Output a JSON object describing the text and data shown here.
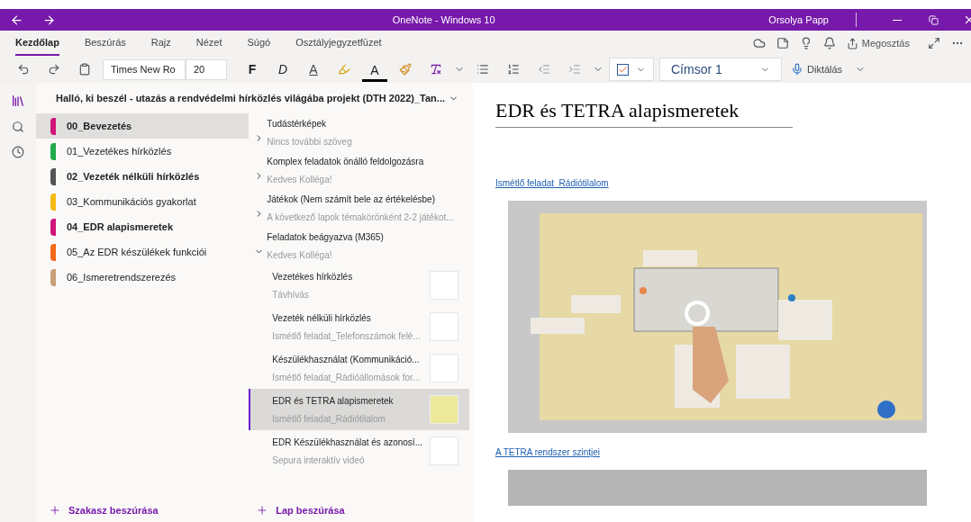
{
  "window": {
    "title": "OneNote - Windows 10",
    "user": "Orsolya Papp"
  },
  "ribbon_tabs": [
    {
      "label": "Kezdőlap",
      "selected": true
    },
    {
      "label": "Beszúrás",
      "selected": false
    },
    {
      "label": "Rajz",
      "selected": false
    },
    {
      "label": "Nézet",
      "selected": false
    },
    {
      "label": "Súgó",
      "selected": false
    },
    {
      "label": "Osztályjegyzetfüzet",
      "selected": false
    }
  ],
  "share": "Megosztás",
  "toolbar": {
    "font": "Times New Ro",
    "size": "20",
    "bold": "F",
    "italic": "D",
    "underline": "A",
    "font_color": "A",
    "tag_checked": true,
    "style": "Címsor 1",
    "dictate": "Diktálás"
  },
  "notebook": {
    "title": "Halló, ki beszél - utazás a rendvédelmi hírközlés világába projekt (DTH 2022)_Tan..."
  },
  "sections": [
    {
      "name": "00_Bevezetés",
      "color": "#d0157a",
      "selected": true,
      "unread": true
    },
    {
      "name": "01_Vezetékes hírközlés",
      "color": "#21a94e",
      "selected": false,
      "unread": false
    },
    {
      "name": "02_Vezeték nélküli hírközlés",
      "color": "#545454",
      "selected": false,
      "unread": true
    },
    {
      "name": "03_Kommunikációs gyakorlat",
      "color": "#f5b915",
      "selected": false,
      "unread": false
    },
    {
      "name": "04_EDR alapismeretek",
      "color": "#d0157a",
      "selected": false,
      "unread": true
    },
    {
      "name": "05_Az EDR készülékek funkciói",
      "color": "#f26a1b",
      "selected": false,
      "unread": false
    },
    {
      "name": "06_Ismeretrendszerezés",
      "color": "#c9a07a",
      "selected": false,
      "unread": false
    }
  ],
  "add_section": "Szakasz beszúrása",
  "pages": [
    {
      "title": "Tudástérképek",
      "preview": "Nincs további szöveg",
      "expanded": false
    },
    {
      "title": "Komplex feladatok önálló feldolgozásra",
      "preview": "Kedves Kolléga!",
      "expanded": false
    },
    {
      "title": "Játékok (Nem számít bele az értékelésbe)",
      "preview": "A következő lapok témakörönként 2-2 játékot...",
      "expanded": false
    },
    {
      "title": "Feladatok beágyazva (M365)",
      "preview": "Kedves Kolléga!",
      "expanded": true,
      "children": [
        {
          "title": "Vezetékes hírközlés",
          "preview": "Távhívás",
          "selected": false
        },
        {
          "title": "Vezeték nélküli hírközlés",
          "preview": "Ismétlő feladat_Telefonszámok felé...",
          "selected": false
        },
        {
          "title": "Készülékhasználat (Kommunikáció...",
          "preview": "Ismétlő feladat_Rádióállomások for...",
          "selected": false
        },
        {
          "title": "EDR és TETRA alapismeretek",
          "preview": "Ismétlő feladat_Rádiótilalom",
          "selected": true
        },
        {
          "title": "EDR Készülékhasználat és azonosí...",
          "preview": "Sepura interaktív videó",
          "selected": false
        }
      ]
    }
  ],
  "add_page": "Lap beszúrása",
  "page": {
    "title": "EDR és TETRA alapismeretek",
    "blocks": [
      {
        "kind": "link",
        "text": "Ismétlő feladat_Rádiótilalom"
      },
      {
        "kind": "picture"
      },
      {
        "kind": "link",
        "text": "A TETRA rendszer szintjei"
      },
      {
        "kind": "frame"
      }
    ]
  }
}
